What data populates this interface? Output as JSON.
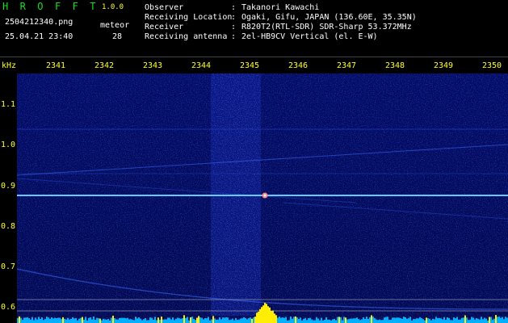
{
  "header": {
    "app_title": "H R O F F T",
    "version": "1.0.0",
    "filename": "2504212340.png",
    "timestamp": "25.04.21 23:40",
    "meteor_label": "meteor",
    "meteor_count": "28"
  },
  "meta": [
    {
      "key": "Observer",
      "value": "Takanori Kawachi"
    },
    {
      "key": "Receiving Location",
      "value": "Ogaki, Gifu, JAPAN (136.60E, 35.35N)"
    },
    {
      "key": "Receiver",
      "value": "R820T2(RTL-SDR) SDR-Sharp 53.372MHz"
    },
    {
      "key": "Receiving antenna",
      "value": "2el-HB9CV Vertical (el. E-W)"
    }
  ],
  "axis": {
    "time_ticks": [
      "2341",
      "2342",
      "2343",
      "2344",
      "2345",
      "2346",
      "2347",
      "2348",
      "2349",
      "2350"
    ],
    "freq_unit": "kHz",
    "freq_ticks": [
      "1.1",
      "1.0",
      "0.9",
      "0.8",
      "0.7",
      "0.6"
    ]
  },
  "colors": {
    "background": "#000000",
    "header_green": "#18e020",
    "header_white": "#ffffff",
    "axis_yellow": "#ffff33",
    "spectrogram_bg": "#020a5a",
    "carrier": "#4fc3ff",
    "meteor": "#ff8080",
    "bottom_bar": "#00b0ff",
    "bottom_peak": "#ffee00"
  }
}
